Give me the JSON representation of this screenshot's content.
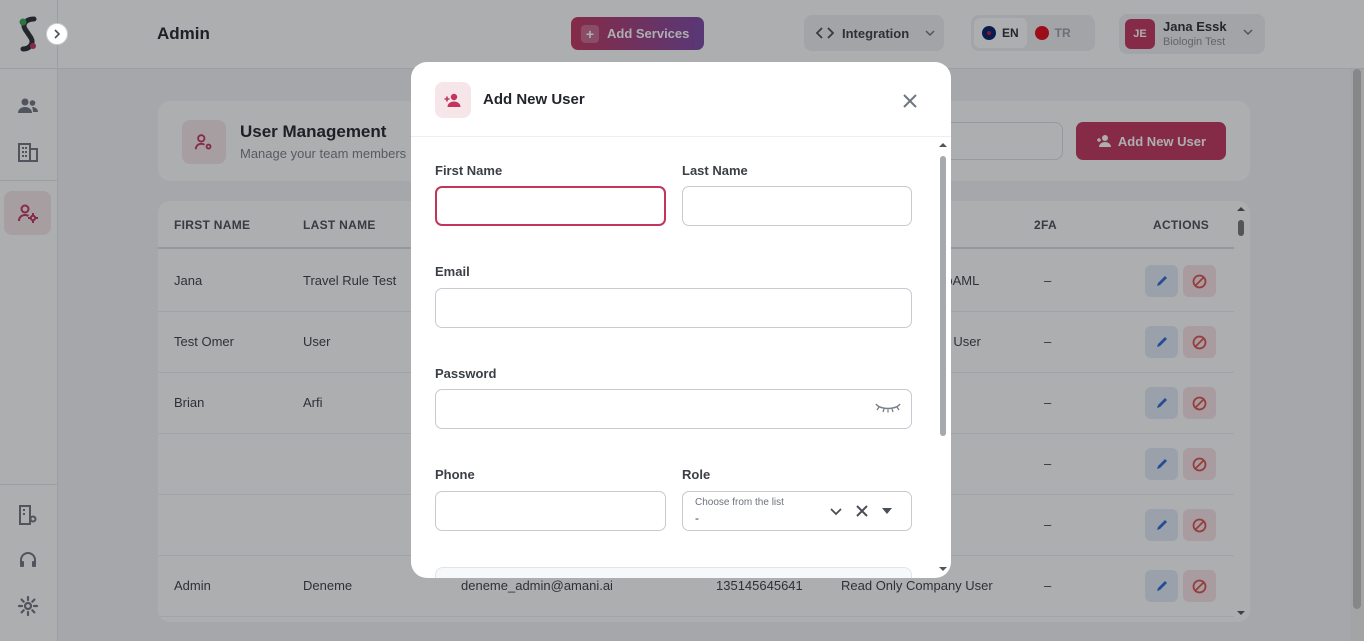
{
  "header": {
    "title": "Admin",
    "add_services_label": "Add Services",
    "integration_label": "Integration",
    "languages": [
      {
        "code": "EN",
        "active": true
      },
      {
        "code": "TR",
        "active": false
      }
    ],
    "user": {
      "initials": "JE",
      "name": "Jana Essk",
      "org": "Biologin Test"
    }
  },
  "sidebar": {
    "items": [
      {
        "icon": "users-icon"
      },
      {
        "icon": "building-icon"
      },
      {
        "icon": "user-settings-icon",
        "active": true
      },
      {
        "icon": "building-settings-icon"
      },
      {
        "icon": "support-headset-icon"
      },
      {
        "icon": "gear-icon"
      }
    ]
  },
  "user_management": {
    "title": "User Management",
    "subtitle": "Manage your team members",
    "add_button_label": "Add New User"
  },
  "table": {
    "columns": [
      "FIRST NAME",
      "LAST NAME",
      "2FA",
      "ACTIONS"
    ],
    "rows": [
      {
        "first": "Jana",
        "last": "Travel Rule Test",
        "email": "",
        "phone": "",
        "role": "NoAML",
        "twofa": "–"
      },
      {
        "first": "Test Omer",
        "last": "User",
        "email": "",
        "phone": "",
        "role": "ny User",
        "twofa": "–"
      },
      {
        "first": "Brian",
        "last": "Arfi",
        "email": "",
        "phone": "",
        "role": "",
        "twofa": "–"
      },
      {
        "first": "",
        "last": "",
        "email": "",
        "phone": "",
        "role": "",
        "twofa": "–"
      },
      {
        "first": "",
        "last": "",
        "email": "",
        "phone": "",
        "role": "",
        "twofa": "–"
      },
      {
        "first": "Admin",
        "last": "Deneme",
        "email": "deneme_admin@amani.ai",
        "phone": "135145645641",
        "role": "Read Only Company User",
        "twofa": "–"
      }
    ]
  },
  "modal": {
    "title": "Add New User",
    "fields": {
      "first_name": {
        "label": "First Name",
        "value": ""
      },
      "last_name": {
        "label": "Last Name",
        "value": ""
      },
      "email": {
        "label": "Email",
        "value": ""
      },
      "password": {
        "label": "Password",
        "value": ""
      },
      "phone": {
        "label": "Phone",
        "value": ""
      },
      "role": {
        "label": "Role",
        "placeholder": "Choose from the list",
        "value": "-"
      }
    }
  },
  "colors": {
    "brand": "#c2365e",
    "brand_light": "#f6e6ea",
    "edit_bg": "#e3ebf7",
    "block_bg": "#f8e3e6"
  }
}
